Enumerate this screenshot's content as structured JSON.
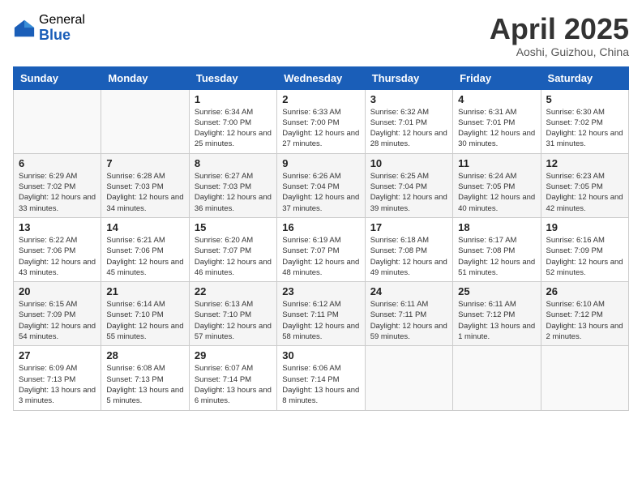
{
  "header": {
    "logo_general": "General",
    "logo_blue": "Blue",
    "month_title": "April 2025",
    "location": "Aoshi, Guizhou, China"
  },
  "days_of_week": [
    "Sunday",
    "Monday",
    "Tuesday",
    "Wednesday",
    "Thursday",
    "Friday",
    "Saturday"
  ],
  "weeks": [
    [
      {
        "day": "",
        "detail": ""
      },
      {
        "day": "",
        "detail": ""
      },
      {
        "day": "1",
        "detail": "Sunrise: 6:34 AM\nSunset: 7:00 PM\nDaylight: 12 hours and 25 minutes."
      },
      {
        "day": "2",
        "detail": "Sunrise: 6:33 AM\nSunset: 7:00 PM\nDaylight: 12 hours and 27 minutes."
      },
      {
        "day": "3",
        "detail": "Sunrise: 6:32 AM\nSunset: 7:01 PM\nDaylight: 12 hours and 28 minutes."
      },
      {
        "day": "4",
        "detail": "Sunrise: 6:31 AM\nSunset: 7:01 PM\nDaylight: 12 hours and 30 minutes."
      },
      {
        "day": "5",
        "detail": "Sunrise: 6:30 AM\nSunset: 7:02 PM\nDaylight: 12 hours and 31 minutes."
      }
    ],
    [
      {
        "day": "6",
        "detail": "Sunrise: 6:29 AM\nSunset: 7:02 PM\nDaylight: 12 hours and 33 minutes."
      },
      {
        "day": "7",
        "detail": "Sunrise: 6:28 AM\nSunset: 7:03 PM\nDaylight: 12 hours and 34 minutes."
      },
      {
        "day": "8",
        "detail": "Sunrise: 6:27 AM\nSunset: 7:03 PM\nDaylight: 12 hours and 36 minutes."
      },
      {
        "day": "9",
        "detail": "Sunrise: 6:26 AM\nSunset: 7:04 PM\nDaylight: 12 hours and 37 minutes."
      },
      {
        "day": "10",
        "detail": "Sunrise: 6:25 AM\nSunset: 7:04 PM\nDaylight: 12 hours and 39 minutes."
      },
      {
        "day": "11",
        "detail": "Sunrise: 6:24 AM\nSunset: 7:05 PM\nDaylight: 12 hours and 40 minutes."
      },
      {
        "day": "12",
        "detail": "Sunrise: 6:23 AM\nSunset: 7:05 PM\nDaylight: 12 hours and 42 minutes."
      }
    ],
    [
      {
        "day": "13",
        "detail": "Sunrise: 6:22 AM\nSunset: 7:06 PM\nDaylight: 12 hours and 43 minutes."
      },
      {
        "day": "14",
        "detail": "Sunrise: 6:21 AM\nSunset: 7:06 PM\nDaylight: 12 hours and 45 minutes."
      },
      {
        "day": "15",
        "detail": "Sunrise: 6:20 AM\nSunset: 7:07 PM\nDaylight: 12 hours and 46 minutes."
      },
      {
        "day": "16",
        "detail": "Sunrise: 6:19 AM\nSunset: 7:07 PM\nDaylight: 12 hours and 48 minutes."
      },
      {
        "day": "17",
        "detail": "Sunrise: 6:18 AM\nSunset: 7:08 PM\nDaylight: 12 hours and 49 minutes."
      },
      {
        "day": "18",
        "detail": "Sunrise: 6:17 AM\nSunset: 7:08 PM\nDaylight: 12 hours and 51 minutes."
      },
      {
        "day": "19",
        "detail": "Sunrise: 6:16 AM\nSunset: 7:09 PM\nDaylight: 12 hours and 52 minutes."
      }
    ],
    [
      {
        "day": "20",
        "detail": "Sunrise: 6:15 AM\nSunset: 7:09 PM\nDaylight: 12 hours and 54 minutes."
      },
      {
        "day": "21",
        "detail": "Sunrise: 6:14 AM\nSunset: 7:10 PM\nDaylight: 12 hours and 55 minutes."
      },
      {
        "day": "22",
        "detail": "Sunrise: 6:13 AM\nSunset: 7:10 PM\nDaylight: 12 hours and 57 minutes."
      },
      {
        "day": "23",
        "detail": "Sunrise: 6:12 AM\nSunset: 7:11 PM\nDaylight: 12 hours and 58 minutes."
      },
      {
        "day": "24",
        "detail": "Sunrise: 6:11 AM\nSunset: 7:11 PM\nDaylight: 12 hours and 59 minutes."
      },
      {
        "day": "25",
        "detail": "Sunrise: 6:11 AM\nSunset: 7:12 PM\nDaylight: 13 hours and 1 minute."
      },
      {
        "day": "26",
        "detail": "Sunrise: 6:10 AM\nSunset: 7:12 PM\nDaylight: 13 hours and 2 minutes."
      }
    ],
    [
      {
        "day": "27",
        "detail": "Sunrise: 6:09 AM\nSunset: 7:13 PM\nDaylight: 13 hours and 3 minutes."
      },
      {
        "day": "28",
        "detail": "Sunrise: 6:08 AM\nSunset: 7:13 PM\nDaylight: 13 hours and 5 minutes."
      },
      {
        "day": "29",
        "detail": "Sunrise: 6:07 AM\nSunset: 7:14 PM\nDaylight: 13 hours and 6 minutes."
      },
      {
        "day": "30",
        "detail": "Sunrise: 6:06 AM\nSunset: 7:14 PM\nDaylight: 13 hours and 8 minutes."
      },
      {
        "day": "",
        "detail": ""
      },
      {
        "day": "",
        "detail": ""
      },
      {
        "day": "",
        "detail": ""
      }
    ]
  ]
}
